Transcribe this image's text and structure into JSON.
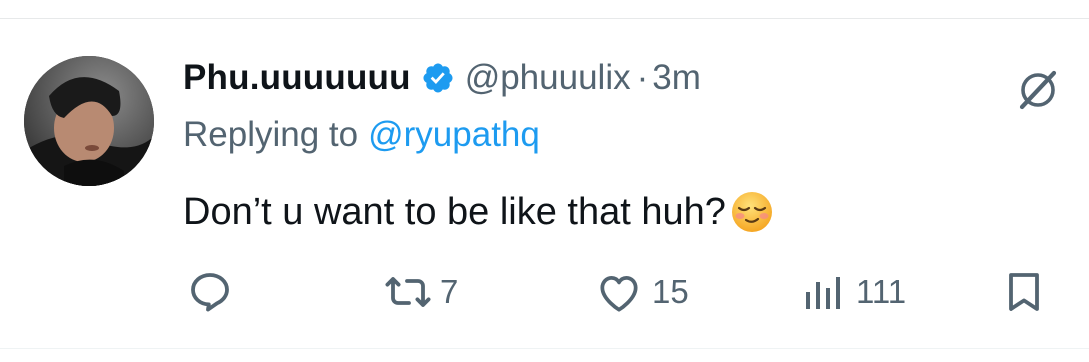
{
  "tweet": {
    "author": {
      "display_name": "Phu.uuuuuuu",
      "handle": "@phuuulix",
      "verified": true,
      "avatar_icon": "profile-photo"
    },
    "separator": "·",
    "time": "3m",
    "replying_prefix": "Replying to",
    "replying_to": "@ryupathq",
    "text": "Don’t u want to be like that huh?",
    "emoji": "relieved-face-emoji",
    "stats": {
      "retweets": "7",
      "likes": "15",
      "views": "111"
    }
  },
  "colors": {
    "accent": "#1d9bf0",
    "text_primary": "#0f1419",
    "text_secondary": "#536471",
    "divider": "#e7e9ea",
    "emoji_yellow": "#fbc531"
  },
  "icons": [
    "verified-badge-icon",
    "grok-icon",
    "reply-icon",
    "retweet-icon",
    "like-icon",
    "views-icon",
    "bookmark-icon"
  ]
}
